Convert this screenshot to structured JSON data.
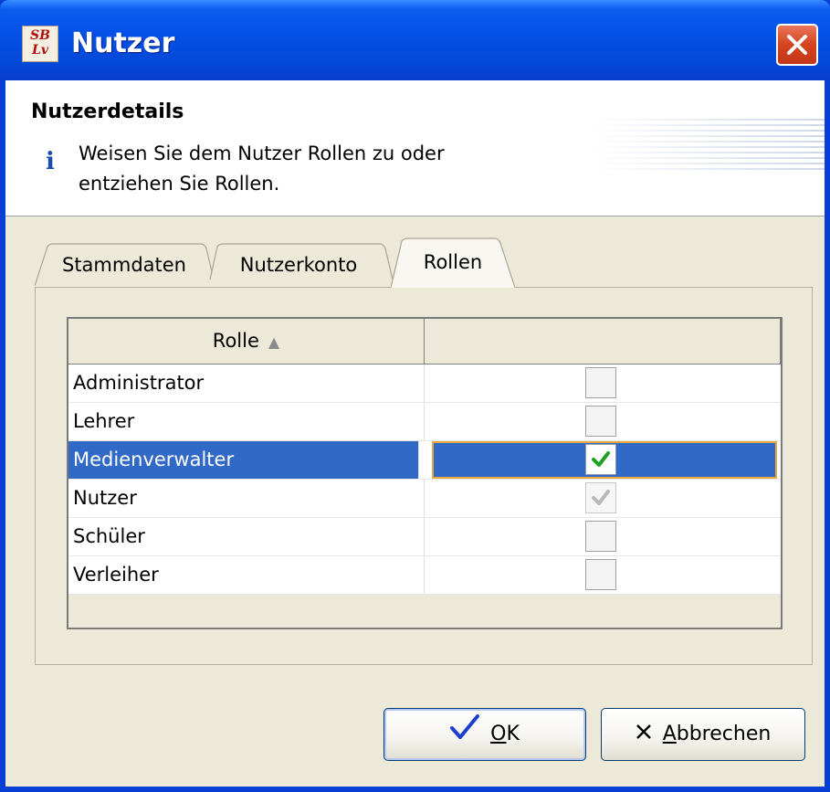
{
  "window": {
    "title": "Nutzer",
    "icon_text_top": "SB",
    "icon_text_bottom": "Lv"
  },
  "header": {
    "title": "Nutzerdetails",
    "message_line1": "Weisen Sie dem Nutzer Rollen zu oder",
    "message_line2": "entziehen Sie Rollen."
  },
  "tabs": [
    {
      "label": "Stammdaten",
      "active": false
    },
    {
      "label": "Nutzerkonto",
      "active": false
    },
    {
      "label": "Rollen",
      "active": true
    }
  ],
  "table": {
    "columns": [
      {
        "label": "Rolle",
        "sort": "ascending"
      },
      {
        "label": ""
      }
    ],
    "rows": [
      {
        "role": "Administrator",
        "checked": false,
        "enabled": true,
        "selected": false
      },
      {
        "role": "Lehrer",
        "checked": false,
        "enabled": true,
        "selected": false
      },
      {
        "role": "Medienverwalter",
        "checked": true,
        "enabled": true,
        "selected": true
      },
      {
        "role": "Nutzer",
        "checked": true,
        "enabled": false,
        "selected": false
      },
      {
        "role": "Schüler",
        "checked": false,
        "enabled": true,
        "selected": false
      },
      {
        "role": "Verleiher",
        "checked": false,
        "enabled": true,
        "selected": false
      }
    ]
  },
  "buttons": {
    "ok_mnemonic": "O",
    "ok_rest": "K",
    "cancel_mnemonic": "A",
    "cancel_rest": "bbrechen"
  },
  "colors": {
    "titlebar": "#0550e6",
    "selection": "#3169c6",
    "check_green": "#21a121",
    "dialog_bg": "#ece9d8"
  }
}
